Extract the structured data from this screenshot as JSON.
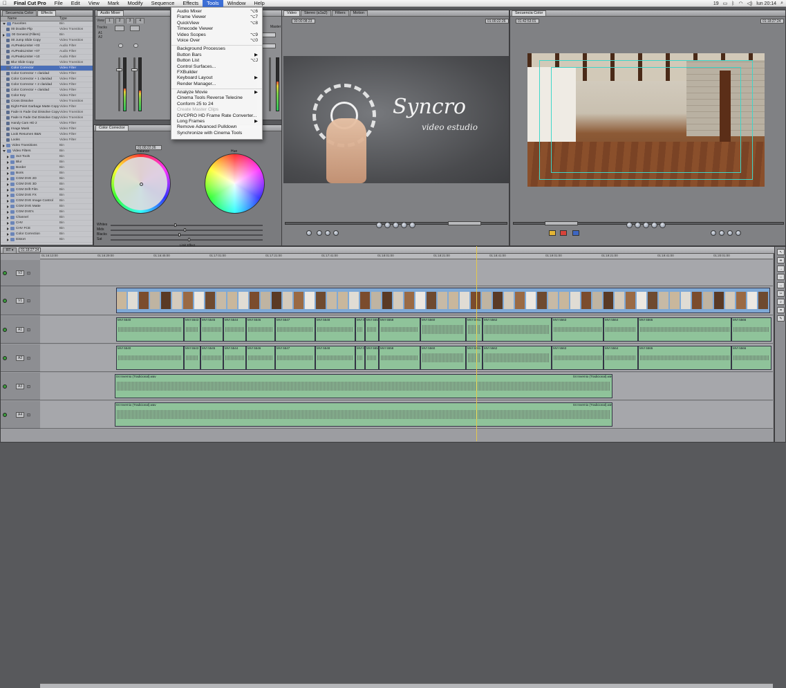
{
  "menubar": {
    "app_name": "Final Cut Pro",
    "items": [
      "File",
      "Edit",
      "View",
      "Mark",
      "Modify",
      "Sequence",
      "Effects",
      "Tools",
      "Window",
      "Help"
    ],
    "active": "Tools",
    "status": {
      "battery_pct": "19",
      "clock": "lun 20:14"
    }
  },
  "tools_menu": [
    {
      "label": "Audio Mixer",
      "shortcut": "⌥6"
    },
    {
      "label": "Frame Viewer",
      "shortcut": "⌥7"
    },
    {
      "label": "QuickView",
      "shortcut": "⌥8"
    },
    {
      "label": "Timecode Viewer",
      "shortcut": ""
    },
    {
      "label": "Video Scopes",
      "shortcut": "⌥9"
    },
    {
      "label": "Voice Over",
      "shortcut": "⌥0"
    },
    {
      "sep": true
    },
    {
      "label": "Background Processes",
      "shortcut": ""
    },
    {
      "label": "Button Bars",
      "shortcut": "▶"
    },
    {
      "label": "Button List",
      "shortcut": "⌥J"
    },
    {
      "label": "Control Surfaces...",
      "shortcut": ""
    },
    {
      "label": "FXBuilder",
      "shortcut": ""
    },
    {
      "label": "Keyboard Layout",
      "shortcut": "▶"
    },
    {
      "label": "Render Manager...",
      "shortcut": ""
    },
    {
      "sep": true
    },
    {
      "label": "Analyze Movie",
      "shortcut": "▶"
    },
    {
      "label": "Cinema Tools Reverse Telecine",
      "shortcut": ""
    },
    {
      "label": "Conform 25 to 24",
      "shortcut": ""
    },
    {
      "label": "Create Master Clips",
      "shortcut": "",
      "disabled": true
    },
    {
      "label": "DVCPRO HD Frame Rate Converter...",
      "shortcut": ""
    },
    {
      "label": "Long Frames",
      "shortcut": "▶"
    },
    {
      "label": "Remove Advanced Pulldown",
      "shortcut": ""
    },
    {
      "label": "Synchronize with Cinema Tools",
      "shortcut": ""
    }
  ],
  "browser": {
    "tabs": [
      "Secuencia Color",
      "Effects"
    ],
    "columns": [
      "Name",
      "Type"
    ],
    "rows": [
      {
        "name": "Favorites",
        "type": "Bin",
        "kind": "folder",
        "open": true
      },
      {
        "name": "00 Double Flip",
        "type": "Video Transition",
        "kind": "fx"
      },
      {
        "name": "00 General (Fillers)",
        "type": "Bin",
        "kind": "folder"
      },
      {
        "name": "00 Jump Slide Copy",
        "type": "Video Transition",
        "kind": "fx"
      },
      {
        "name": "AUPeakLimiter +03",
        "type": "Audio Filter",
        "kind": "fx"
      },
      {
        "name": "AUPeakLimiter +07",
        "type": "Audio Filter",
        "kind": "fx"
      },
      {
        "name": "AUPeakLimiter +10",
        "type": "Audio Filter",
        "kind": "fx"
      },
      {
        "name": "Blur Slide Copy",
        "type": "Video Transition",
        "kind": "fx"
      },
      {
        "name": "Color Corrector",
        "type": "Video Filter",
        "kind": "fx",
        "selected": true
      },
      {
        "name": "Color Corrector + claridad",
        "type": "Video Filter",
        "kind": "fx"
      },
      {
        "name": "Color Corrector + 1 claridad",
        "type": "Video Filter",
        "kind": "fx"
      },
      {
        "name": "Color Corrector + 2 claridad",
        "type": "Video Filter",
        "kind": "fx"
      },
      {
        "name": "Color Corrector + claridad",
        "type": "Video Filter",
        "kind": "fx"
      },
      {
        "name": "Color Key",
        "type": "Video Filter",
        "kind": "fx"
      },
      {
        "name": "Cross Dissolve",
        "type": "Video Transition",
        "kind": "fx"
      },
      {
        "name": "Eight-Point Garbage Matte Copy",
        "type": "Video Filter",
        "kind": "fx"
      },
      {
        "name": "Fade In Fade Out Dissolve Copy",
        "type": "Video Transition",
        "kind": "fx"
      },
      {
        "name": "Fade In Fade Out Dissolve Copy",
        "type": "Video Transition",
        "kind": "fx"
      },
      {
        "name": "Handy Cam HD 2",
        "type": "Video Filter",
        "kind": "fx"
      },
      {
        "name": "Image Mask",
        "type": "Video Filter",
        "kind": "fx"
      },
      {
        "name": "Look Resumen B&N",
        "type": "Video Filter",
        "kind": "fx"
      },
      {
        "name": "Looks",
        "type": "Video Filter",
        "kind": "fx"
      },
      {
        "name": "Video Transitions",
        "type": "Bin",
        "kind": "folder"
      },
      {
        "name": "Video Filters",
        "type": "Bin",
        "kind": "folder",
        "open": true
      },
      {
        "name": "3x3 Tools",
        "type": "Bin",
        "kind": "folder",
        "indent": true
      },
      {
        "name": "Blur",
        "type": "Bin",
        "kind": "folder",
        "indent": true
      },
      {
        "name": "Border",
        "type": "Bin",
        "kind": "folder",
        "indent": true
      },
      {
        "name": "Boris",
        "type": "Bin",
        "kind": "folder",
        "indent": true
      },
      {
        "name": "CGM DVE 2D",
        "type": "Bin",
        "kind": "folder",
        "indent": true
      },
      {
        "name": "CGM DVE 3D",
        "type": "Bin",
        "kind": "folder",
        "indent": true
      },
      {
        "name": "CGM Drift Film",
        "type": "Bin",
        "kind": "folder",
        "indent": true
      },
      {
        "name": "CGM DVE FX",
        "type": "Bin",
        "kind": "folder",
        "indent": true
      },
      {
        "name": "CGM DVE Image Control",
        "type": "Bin",
        "kind": "folder",
        "indent": true
      },
      {
        "name": "CGM DVE Matte",
        "type": "Bin",
        "kind": "folder",
        "indent": true
      },
      {
        "name": "CGM DVE's",
        "type": "Bin",
        "kind": "folder",
        "indent": true
      },
      {
        "name": "Channel",
        "type": "Bin",
        "kind": "folder",
        "indent": true
      },
      {
        "name": "CHV",
        "type": "Bin",
        "kind": "folder",
        "indent": true
      },
      {
        "name": "CHV FCE",
        "type": "Bin",
        "kind": "folder",
        "indent": true
      },
      {
        "name": "Color Correction",
        "type": "Bin",
        "kind": "folder",
        "indent": true
      },
      {
        "name": "Distort",
        "type": "Bin",
        "kind": "folder",
        "indent": true
      }
    ]
  },
  "mixer": {
    "tab": "Audio Mixer",
    "view_label": "View",
    "tracks_label": "Tracks",
    "track_names": [
      "A1",
      "A2"
    ],
    "master_label": "Master",
    "levels": [
      0.42,
      0.38
    ],
    "master_level": 0.55
  },
  "color_corrector": {
    "tab": "Color Corrector",
    "timecode": "01:00:22:26",
    "balance_label": "Balance",
    "hue_label": "Hue",
    "sliders": [
      "Whites",
      "Mids",
      "Blacks",
      "Sat"
    ],
    "limit_effect": "Limit Effect"
  },
  "viewer": {
    "tabs": [
      "Video",
      "Stereo (a1a2)",
      "Filters",
      "Motion"
    ],
    "tc_left": "00:00:08:23",
    "tc_right": "01:00:22:26",
    "title_text": "Syncro",
    "subtitle_text": "video estudio"
  },
  "canvas": {
    "tab": "Secuencia Color",
    "tc_left": "01:42:53:01",
    "tc_right": "01:18:27:24"
  },
  "timeline": {
    "timecode": "01:18:27:24",
    "ruler": [
      "01:16:13:00",
      "01:16:29:00",
      "01:16:45:00",
      "01:17:01:00",
      "01:17:21:00",
      "01:17:41:00",
      "01:18:01:00",
      "01:18:21:00",
      "01:18:41:00",
      "01:19:01:00",
      "01:19:21:00",
      "01:19:41:00",
      "01:20:01:00"
    ],
    "tracks": {
      "v2": "V2",
      "v1": "V1",
      "a1": "A1",
      "a2": "A2",
      "a3": "A3",
      "a4": "A4"
    },
    "audio_clips": [
      "MVI 5540",
      "MVI 5543",
      "MVI 5545",
      "MVI 5544",
      "MVI 5546",
      "MVI 5547",
      "MVI 5548",
      "MVI 5549",
      "MVI 5550",
      "MVI 5558",
      "MVI 5560",
      "MVI 5561",
      "MVI 5562",
      "MVI 5563",
      "MVI 5564",
      "MVI 5565",
      "MVI 5566"
    ],
    "music_clip": "04 Invernio (Tradicional).wav"
  }
}
